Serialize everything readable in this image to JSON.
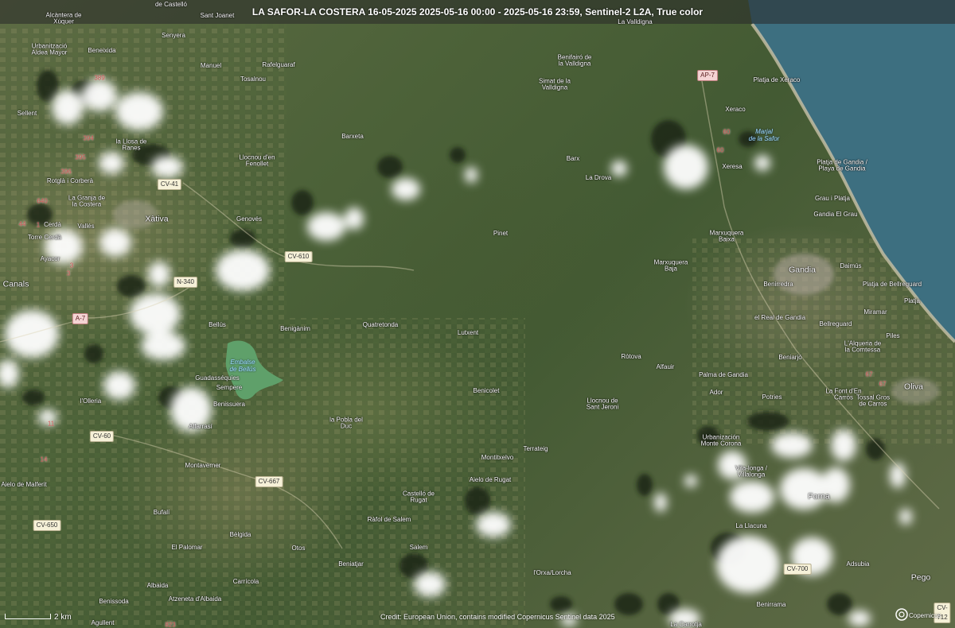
{
  "header": {
    "title": "LA SAFOR-LA COSTERA 16-05-2025 2025-05-16 00:00 - 2025-05-16 23:59, Sentinel-2 L2A, True color"
  },
  "places": [
    {
      "id": "alcantera",
      "text": "Alcàntera de\nXúquer"
    },
    {
      "id": "castello",
      "text": "de Castelló"
    },
    {
      "id": "santjoanet",
      "text": "Sant Joanet"
    },
    {
      "id": "lavalldigna",
      "text": "La Valldigna"
    },
    {
      "id": "urbanitzacio",
      "text": "Urbanització\nAldea Mayor"
    },
    {
      "id": "beneixida",
      "text": "Beneixida"
    },
    {
      "id": "senyera",
      "text": "Senyera"
    },
    {
      "id": "manuel",
      "text": "Manuel"
    },
    {
      "id": "rafelguaraf",
      "text": "Rafelguaraf"
    },
    {
      "id": "tosalnou",
      "text": "Tosalnou"
    },
    {
      "id": "benifairo",
      "text": "Benifairó de\nla Valldigna"
    },
    {
      "id": "simat",
      "text": "Simat de la\nValldigna"
    },
    {
      "id": "xeracobeach",
      "text": "Platja de Xeraco"
    },
    {
      "id": "sellent",
      "text": "Sellent"
    },
    {
      "id": "llosa",
      "text": "la Llosa de\nRanes"
    },
    {
      "id": "barxeta",
      "text": "Barxeta"
    },
    {
      "id": "xeraco",
      "text": "Xeraco"
    },
    {
      "id": "llocnou1",
      "text": "Llocnou d'en\nFenollet"
    },
    {
      "id": "barx",
      "text": "Barx"
    },
    {
      "id": "xeresa",
      "text": "Xeresa"
    },
    {
      "id": "gandiabeach",
      "text": "Platja de Gandia /\nPlaya de Gandia"
    },
    {
      "id": "rotglà",
      "text": "Rotglà i Corberà"
    },
    {
      "id": "ladrova",
      "text": "La Drova"
    },
    {
      "id": "lagranja",
      "text": "La Granja de\nla Costera"
    },
    {
      "id": "grau",
      "text": "Grau i Platja"
    },
    {
      "id": "genoves",
      "text": "Genovés"
    },
    {
      "id": "xativa",
      "text": "Xàtiva"
    },
    {
      "id": "gandiagrau",
      "text": "Gandia El Grau"
    },
    {
      "id": "cerda",
      "text": "Cerdà"
    },
    {
      "id": "valles",
      "text": "Vallés"
    },
    {
      "id": "pinet",
      "text": "Pinet"
    },
    {
      "id": "torrecerda",
      "text": "Torre Cerdà"
    },
    {
      "id": "marxbaixa",
      "text": "Marxuquera\nBaixa"
    },
    {
      "id": "ayacor",
      "text": "Ayacor"
    },
    {
      "id": "daimus",
      "text": "Daimús"
    },
    {
      "id": "canals",
      "text": "Canals"
    },
    {
      "id": "marxbaja",
      "text": "Marxuquera\nBaja"
    },
    {
      "id": "gandia",
      "text": "Gandia"
    },
    {
      "id": "benirredra",
      "text": "Benirredra"
    },
    {
      "id": "bellreguard_beach",
      "text": "Platja de Bellreguard"
    },
    {
      "id": "miramar",
      "text": "Miramar"
    },
    {
      "id": "platja",
      "text": "Platja"
    },
    {
      "id": "realgandia",
      "text": "el Real de Gandia"
    },
    {
      "id": "bellreguard",
      "text": "Bellreguard"
    },
    {
      "id": "bellus",
      "text": "Bellús"
    },
    {
      "id": "beniganim",
      "text": "Benigànim"
    },
    {
      "id": "quatretonda",
      "text": "Quatretonda"
    },
    {
      "id": "lutxent",
      "text": "Lutxent"
    },
    {
      "id": "piles",
      "text": "Piles"
    },
    {
      "id": "rotova",
      "text": "Ròtova"
    },
    {
      "id": "alqueria",
      "text": "L'Alqueria de\nla Comtessa"
    },
    {
      "id": "alfauir",
      "text": "Alfauir"
    },
    {
      "id": "beniarjo",
      "text": "Beniarjó"
    },
    {
      "id": "palmagandia",
      "text": "Palma de Gandia"
    },
    {
      "id": "ador",
      "text": "Ador"
    },
    {
      "id": "guadasequies",
      "text": "Guadasséquies"
    },
    {
      "id": "sempere",
      "text": "Sempere"
    },
    {
      "id": "benicolet",
      "text": "Benicolet"
    },
    {
      "id": "potries",
      "text": "Potries"
    },
    {
      "id": "lafont",
      "text": "La Font d'En\nCarròs"
    },
    {
      "id": "oliva",
      "text": "Oliva"
    },
    {
      "id": "tossal",
      "text": "Tossal Gros\nde Carros"
    },
    {
      "id": "olleria",
      "text": "l'Olleria"
    },
    {
      "id": "benissuera",
      "text": "Benissuera"
    },
    {
      "id": "llocnou2",
      "text": "Llocnou de\nSant Jeroni"
    },
    {
      "id": "lapobla",
      "text": "la Pobla del\nDuc"
    },
    {
      "id": "alfarrasi",
      "text": "Alfarrasí"
    },
    {
      "id": "urbmonte",
      "text": "Urbanización\nMonte Corona"
    },
    {
      "id": "terrateig",
      "text": "Terrateig"
    },
    {
      "id": "montitxelvo",
      "text": "Montitxelvo"
    },
    {
      "id": "montaverner",
      "text": "Montaverner"
    },
    {
      "id": "villalonga",
      "text": "Vila-longa /\nVillalonga"
    },
    {
      "id": "malferit",
      "text": "Aielo de Malferit"
    },
    {
      "id": "aielorugat",
      "text": "Aielo de Rugat"
    },
    {
      "id": "forna",
      "text": "Forna"
    },
    {
      "id": "castellorugat",
      "text": "Castelló de\nRugat"
    },
    {
      "id": "bufali",
      "text": "Bufalí"
    },
    {
      "id": "rafol",
      "text": "Ràfol de Salem"
    },
    {
      "id": "lalacuna",
      "text": "La Llacuna"
    },
    {
      "id": "belgida",
      "text": "Bèlgida"
    },
    {
      "id": "elpalomar",
      "text": "El Palomar"
    },
    {
      "id": "otos",
      "text": "Otos"
    },
    {
      "id": "salem",
      "text": "Salem"
    },
    {
      "id": "beniatjar",
      "text": "Beniatjar"
    },
    {
      "id": "adsubia",
      "text": "Adsubia"
    },
    {
      "id": "pego",
      "text": "Pego"
    },
    {
      "id": "lorxa",
      "text": "l'Orxa/Lorcha"
    },
    {
      "id": "carricola",
      "text": "Carrícola"
    },
    {
      "id": "albaida",
      "text": "Albaida"
    },
    {
      "id": "atzeneta",
      "text": "Atzeneta d'Albaida"
    },
    {
      "id": "benissoda",
      "text": "Benissoda"
    },
    {
      "id": "benirrama",
      "text": "Benirrama"
    },
    {
      "id": "agullent",
      "text": "Agullent"
    },
    {
      "id": "lacarrotja",
      "text": "La Carrotja"
    }
  ],
  "roads": [
    {
      "id": "ap7",
      "text": "AP-7"
    },
    {
      "id": "cv41",
      "text": "CV-41"
    },
    {
      "id": "cv610",
      "text": "CV-610"
    },
    {
      "id": "n340",
      "text": "N-340"
    },
    {
      "id": "a7",
      "text": "A-7"
    },
    {
      "id": "cv60",
      "text": "CV-60"
    },
    {
      "id": "cv667",
      "text": "CV-667"
    },
    {
      "id": "cv650",
      "text": "CV-650"
    },
    {
      "id": "cv700",
      "text": "CV-700"
    },
    {
      "id": "cv712",
      "text": "CV-712"
    }
  ],
  "route_numbers": [
    {
      "id": "n389",
      "text": "389"
    },
    {
      "id": "n394",
      "text": "394"
    },
    {
      "id": "n395",
      "text": "395"
    },
    {
      "id": "n396",
      "text": "396"
    },
    {
      "id": "n640",
      "text": "640"
    },
    {
      "id": "n44",
      "text": "44"
    },
    {
      "id": "n1",
      "text": "1"
    },
    {
      "id": "n3a",
      "text": "3"
    },
    {
      "id": "n3b",
      "text": "3"
    },
    {
      "id": "n60a",
      "text": "60"
    },
    {
      "id": "n60b",
      "text": "60"
    },
    {
      "id": "n67a",
      "text": "67"
    },
    {
      "id": "n67b",
      "text": "67"
    },
    {
      "id": "n11",
      "text": "11"
    },
    {
      "id": "n14",
      "text": "14"
    },
    {
      "id": "n823",
      "text": "823"
    }
  ],
  "water_labels": {
    "embalse": "Embalse\nde Bellús",
    "marjal": "Marjal\nde la Safor"
  },
  "scale": {
    "label": "2 km"
  },
  "credit": "Credit: European Union, contains modified Copernicus Sentinel data 2025",
  "logo_text": "Copernicus",
  "colors": {
    "sea": "#3d6f80",
    "land": "#4d6239",
    "cloud": "#ffffff",
    "reservoir": "#5fa06a"
  }
}
